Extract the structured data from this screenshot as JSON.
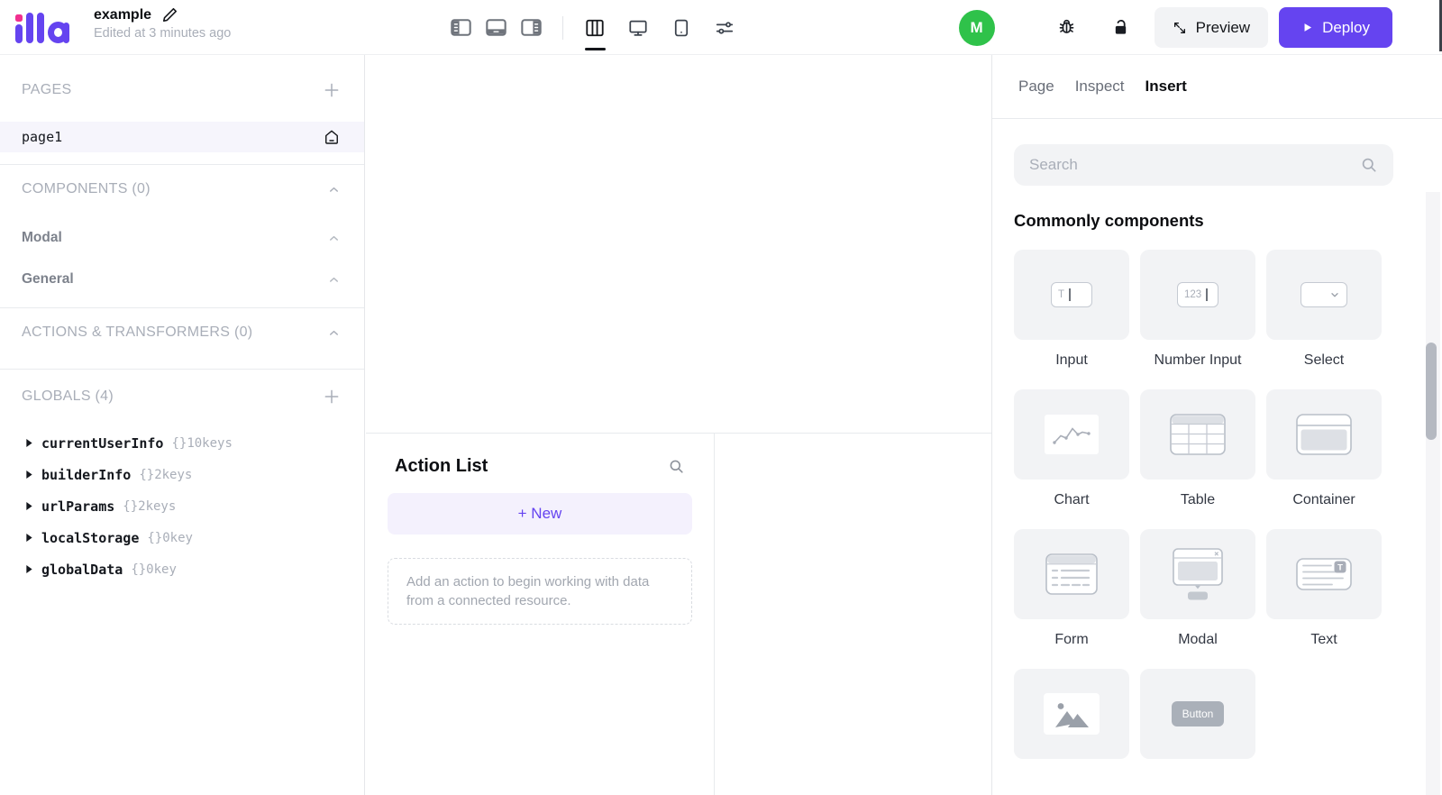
{
  "topbar": {
    "logo_text": "illa",
    "app_name": "example",
    "edited_status": "Edited at 3 minutes ago",
    "avatar_initial": "M",
    "preview_label": "Preview",
    "deploy_label": "Deploy",
    "panel_toggle_icons": [
      "panel-left",
      "panel-bottom",
      "panel-right"
    ],
    "view_mode_icons": [
      {
        "icon": "fit-canvas",
        "active": true
      },
      {
        "icon": "desktop",
        "active": false
      },
      {
        "icon": "tablet",
        "active": false
      },
      {
        "icon": "adjust",
        "active": false
      }
    ],
    "right_icons": [
      "bug",
      "unlock"
    ],
    "colors": {
      "brand_purple": "#6544f0",
      "logo_dot_pink": "#f1308f",
      "avatar_green": "#2fc24a"
    }
  },
  "left_sidebar": {
    "pages_title": "PAGES",
    "page_item": "page1",
    "components_title": "COMPONENTS (0)",
    "component_groups": [
      "Modal",
      "General"
    ],
    "actions_title": "ACTIONS & TRANSFORMERS (0)",
    "globals": {
      "title": "GLOBALS (4)",
      "items": [
        {
          "name": "currentUserInfo",
          "meta": "{}10keys"
        },
        {
          "name": "builderInfo",
          "meta": "{}2keys"
        },
        {
          "name": "urlParams",
          "meta": "{}2keys"
        },
        {
          "name": "localStorage",
          "meta": "{}0key"
        },
        {
          "name": "globalData",
          "meta": "{}0key"
        }
      ]
    }
  },
  "action_panel": {
    "title": "Action List",
    "new_button_label": "+ New",
    "empty_hint": "Add an action to begin working with data from a connected resource."
  },
  "right_panel": {
    "tabs": [
      {
        "label": "Page",
        "active": false
      },
      {
        "label": "Inspect",
        "active": false
      },
      {
        "label": "Insert",
        "active": true
      }
    ],
    "search_placeholder": "Search",
    "section_title": "Commonly components",
    "components": [
      {
        "id": "input",
        "label": "Input",
        "icon": "input"
      },
      {
        "id": "number-input",
        "label": "Number Input",
        "icon": "number-input"
      },
      {
        "id": "select",
        "label": "Select",
        "icon": "select"
      },
      {
        "id": "chart",
        "label": "Chart",
        "icon": "chart"
      },
      {
        "id": "table",
        "label": "Table",
        "icon": "table"
      },
      {
        "id": "container",
        "label": "Container",
        "icon": "container"
      },
      {
        "id": "form",
        "label": "Form",
        "icon": "form"
      },
      {
        "id": "modal",
        "label": "Modal",
        "icon": "modal"
      },
      {
        "id": "text",
        "label": "Text",
        "icon": "text"
      },
      {
        "id": "image",
        "label": "",
        "icon": "image"
      },
      {
        "id": "button",
        "label": "",
        "icon": "button",
        "button_text": "Button"
      }
    ]
  }
}
